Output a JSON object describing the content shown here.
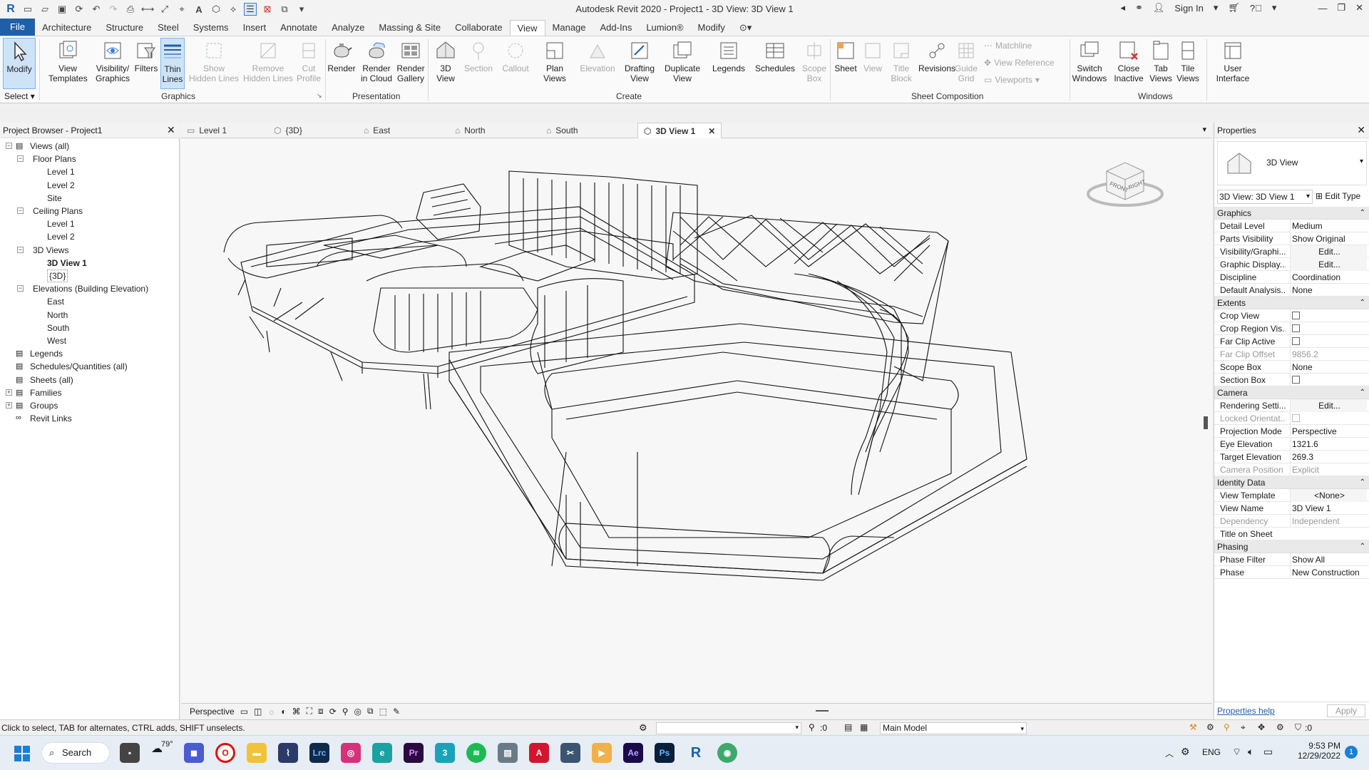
{
  "window": {
    "title": "Autodesk Revit 2020 - Project1 - 3D View: 3D View 1",
    "sign_in": "Sign In"
  },
  "ribbon_tabs": [
    "File",
    "Architecture",
    "Structure",
    "Steel",
    "Systems",
    "Insert",
    "Annotate",
    "Analyze",
    "Massing & Site",
    "Collaborate",
    "View",
    "Manage",
    "Add-Ins",
    "Lumion®",
    "Modify"
  ],
  "active_tab": "View",
  "ribbon": {
    "modify": "Modify",
    "select": "Select",
    "graphics": {
      "label": "Graphics",
      "view_templates": "View\nTemplates",
      "visibility_graphics": "Visibility/\nGraphics",
      "filters": "Filters",
      "thin_lines": "Thin\nLines",
      "show_hidden_lines": "Show\nHidden Lines",
      "remove_hidden_lines": "Remove\nHidden Lines",
      "cut_profile": "Cut\nProfile"
    },
    "presentation": {
      "label": "Presentation",
      "render": "Render",
      "render_in_cloud": "Render\nin Cloud",
      "render_gallery": "Render\nGallery"
    },
    "create": {
      "label": "Create",
      "view_3d": "3D\nView",
      "section": "Section",
      "callout": "Callout",
      "plan_views": "Plan\nViews",
      "elevation": "Elevation",
      "drafting_view": "Drafting\nView",
      "duplicate_view": "Duplicate\nView",
      "legends": "Legends",
      "schedules": "Schedules",
      "scope_box": "Scope\nBox"
    },
    "sheet_composition": {
      "label": "Sheet Composition",
      "sheet": "Sheet",
      "view": "View",
      "title_block": "Title\nBlock",
      "revisions": "Revisions",
      "guide_grid": "Guide\nGrid",
      "matchline": "Matchline",
      "view_reference": "View  Reference",
      "viewports": "Viewports"
    },
    "windows": {
      "label": "Windows",
      "switch_windows": "Switch\nWindows",
      "close_inactive": "Close\nInactive",
      "tab_views": "Tab\nViews",
      "tile_views": "Tile\nViews",
      "user_interface": "User\nInterface"
    }
  },
  "project_browser": {
    "title": "Project Browser - Project1",
    "items": [
      {
        "label": "Views (all)",
        "level": 0,
        "toggle": "−"
      },
      {
        "label": "Floor Plans",
        "level": 1,
        "toggle": "−"
      },
      {
        "label": "Level 1",
        "level": 2
      },
      {
        "label": "Level 2",
        "level": 2
      },
      {
        "label": "Site",
        "level": 2
      },
      {
        "label": "Ceiling Plans",
        "level": 1,
        "toggle": "−"
      },
      {
        "label": "Level 1",
        "level": 2
      },
      {
        "label": "Level 2",
        "level": 2
      },
      {
        "label": "3D Views",
        "level": 1,
        "toggle": "−"
      },
      {
        "label": "3D View 1",
        "level": 2,
        "bold": true
      },
      {
        "label": "{3D}",
        "level": 2,
        "selected": true
      },
      {
        "label": "Elevations (Building Elevation)",
        "level": 1,
        "toggle": "−"
      },
      {
        "label": "East",
        "level": 2
      },
      {
        "label": "North",
        "level": 2
      },
      {
        "label": "South",
        "level": 2
      },
      {
        "label": "West",
        "level": 2
      },
      {
        "label": "Legends",
        "level": 0
      },
      {
        "label": "Schedules/Quantities (all)",
        "level": 0
      },
      {
        "label": "Sheets (all)",
        "level": 0
      },
      {
        "label": "Families",
        "level": 0,
        "toggle": "+"
      },
      {
        "label": "Groups",
        "level": 0,
        "toggle": "+"
      },
      {
        "label": "Revit Links",
        "level": 0
      }
    ]
  },
  "view_tabs": [
    {
      "label": "Level 1",
      "icon": "floor-plan-icon"
    },
    {
      "label": "{3D}",
      "icon": "3d-view-icon"
    },
    {
      "label": "East",
      "icon": "elevation-icon"
    },
    {
      "label": "North",
      "icon": "elevation-icon"
    },
    {
      "label": "South",
      "icon": "elevation-icon"
    },
    {
      "label": "3D View 1",
      "icon": "3d-view-icon",
      "active": true
    }
  ],
  "view_control_bar": {
    "scale": "Perspective"
  },
  "properties": {
    "title": "Properties",
    "type_name": "3D View",
    "selector": "3D View: 3D View 1",
    "edit_type": "Edit Type",
    "groups": [
      {
        "name": "Graphics",
        "rows": [
          {
            "k": "Detail Level",
            "v": "Medium"
          },
          {
            "k": "Parts Visibility",
            "v": "Show Original"
          },
          {
            "k": "Visibility/Graphi...",
            "v": "Edit...",
            "button": true
          },
          {
            "k": "Graphic Display...",
            "v": "Edit...",
            "button": true
          },
          {
            "k": "Discipline",
            "v": "Coordination"
          },
          {
            "k": "Default Analysis...",
            "v": "None"
          }
        ]
      },
      {
        "name": "Extents",
        "rows": [
          {
            "k": "Crop View",
            "check": true
          },
          {
            "k": "Crop Region Vis...",
            "check": true
          },
          {
            "k": "Far Clip Active",
            "check": true
          },
          {
            "k": "Far Clip Offset",
            "v": "9856.2",
            "dim": true
          },
          {
            "k": "Scope Box",
            "v": "None"
          },
          {
            "k": "Section Box",
            "check": true
          }
        ]
      },
      {
        "name": "Camera",
        "rows": [
          {
            "k": "Rendering Setti...",
            "v": "Edit...",
            "button": true
          },
          {
            "k": "Locked Orientat...",
            "check": true,
            "dim": true
          },
          {
            "k": "Projection Mode",
            "v": "Perspective"
          },
          {
            "k": "Eye Elevation",
            "v": "1321.6"
          },
          {
            "k": "Target Elevation",
            "v": "269.3"
          },
          {
            "k": "Camera Position",
            "v": "Explicit",
            "dim": true
          }
        ]
      },
      {
        "name": "Identity Data",
        "rows": [
          {
            "k": "View Template",
            "v": "<None>",
            "button": true
          },
          {
            "k": "View Name",
            "v": "3D View 1"
          },
          {
            "k": "Dependency",
            "v": "Independent",
            "dim": true
          },
          {
            "k": "Title on Sheet",
            "v": ""
          }
        ]
      },
      {
        "name": "Phasing",
        "rows": [
          {
            "k": "Phase Filter",
            "v": "Show All"
          },
          {
            "k": "Phase",
            "v": "New Construction"
          }
        ]
      }
    ],
    "help_link": "Properties help",
    "apply": "Apply"
  },
  "viewcube": {
    "front": "FRONT",
    "right": "RIGHT"
  },
  "status_bar": {
    "hint": "Click to select, TAB for alternates, CTRL adds, SHIFT unselects.",
    "count": ":0",
    "model": "Main Model",
    "filter_count": ":0"
  },
  "taskbar": {
    "search": "Search",
    "weather": "79°",
    "language": "ENG",
    "time": "9:53 PM",
    "date": "12/29/2022",
    "notifications": "1"
  }
}
